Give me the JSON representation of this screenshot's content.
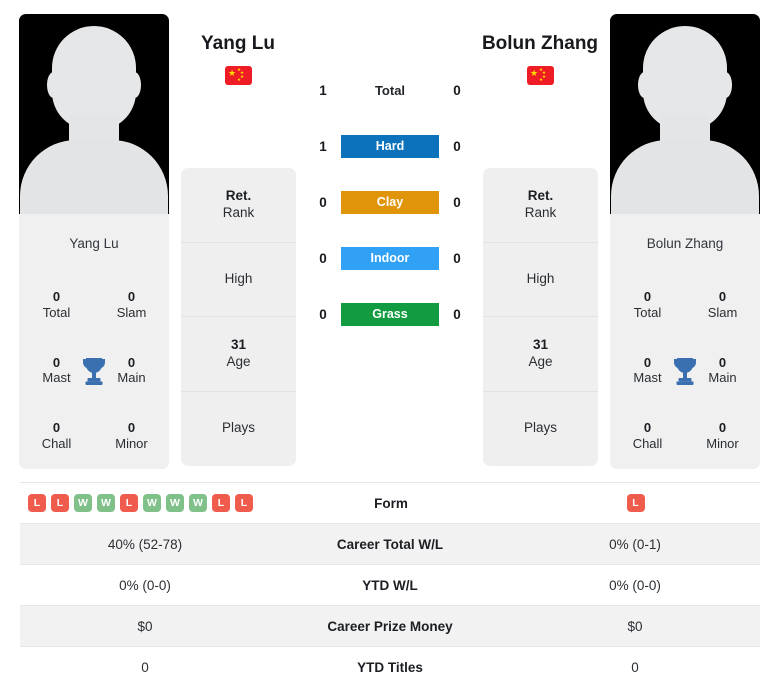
{
  "players": {
    "left": {
      "name": "Yang Lu",
      "photo_caption": "Yang Lu",
      "flag": "cn-flag-icon",
      "titles": [
        {
          "num": "0",
          "label": "Total"
        },
        {
          "num": "0",
          "label": "Slam"
        },
        {
          "num": "0",
          "label": "Mast"
        },
        {
          "num": "0",
          "label": "Main"
        },
        {
          "num": "0",
          "label": "Chall"
        },
        {
          "num": "0",
          "label": "Minor"
        }
      ],
      "info": [
        {
          "value": "Ret.",
          "key": "Rank"
        },
        {
          "value": "",
          "key": "High"
        },
        {
          "value": "31",
          "key": "Age"
        },
        {
          "value": "",
          "key": "Plays"
        }
      ]
    },
    "right": {
      "name": "Bolun Zhang",
      "photo_caption": "Bolun Zhang",
      "flag": "cn-flag-icon",
      "titles": [
        {
          "num": "0",
          "label": "Total"
        },
        {
          "num": "0",
          "label": "Slam"
        },
        {
          "num": "0",
          "label": "Mast"
        },
        {
          "num": "0",
          "label": "Main"
        },
        {
          "num": "0",
          "label": "Chall"
        },
        {
          "num": "0",
          "label": "Minor"
        }
      ],
      "info": [
        {
          "value": "Ret.",
          "key": "Rank"
        },
        {
          "value": "",
          "key": "High"
        },
        {
          "value": "31",
          "key": "Age"
        },
        {
          "value": "",
          "key": "Plays"
        }
      ]
    }
  },
  "h2h": [
    {
      "left": "1",
      "label": "Total",
      "right": "0",
      "pill": false,
      "color": ""
    },
    {
      "left": "1",
      "label": "Hard",
      "right": "0",
      "pill": true,
      "color": "#0c72bb"
    },
    {
      "left": "0",
      "label": "Clay",
      "right": "0",
      "pill": true,
      "color": "#e0940a"
    },
    {
      "left": "0",
      "label": "Indoor",
      "right": "0",
      "pill": true,
      "color": "#30a1f5"
    },
    {
      "left": "0",
      "label": "Grass",
      "right": "0",
      "pill": true,
      "color": "#129b41"
    }
  ],
  "stats": {
    "form_label": "Form",
    "left_form": [
      "L",
      "L",
      "W",
      "W",
      "L",
      "W",
      "W",
      "W",
      "L",
      "L"
    ],
    "right_form": [
      "L"
    ],
    "rows": [
      {
        "left": "40% (52-78)",
        "label": "Career Total W/L",
        "right": "0% (0-1)"
      },
      {
        "left": "0% (0-0)",
        "label": "YTD W/L",
        "right": "0% (0-0)"
      },
      {
        "left": "$0",
        "label": "Career Prize Money",
        "right": "$0"
      },
      {
        "left": "0",
        "label": "YTD Titles",
        "right": "0"
      }
    ]
  },
  "colors": {
    "hard": "#0c72bb",
    "clay": "#e0940a",
    "indoor": "#30a1f5",
    "grass": "#129b41",
    "win": "#80c18a",
    "loss": "#ef5b4c",
    "trophy": "#3a6fb0"
  }
}
